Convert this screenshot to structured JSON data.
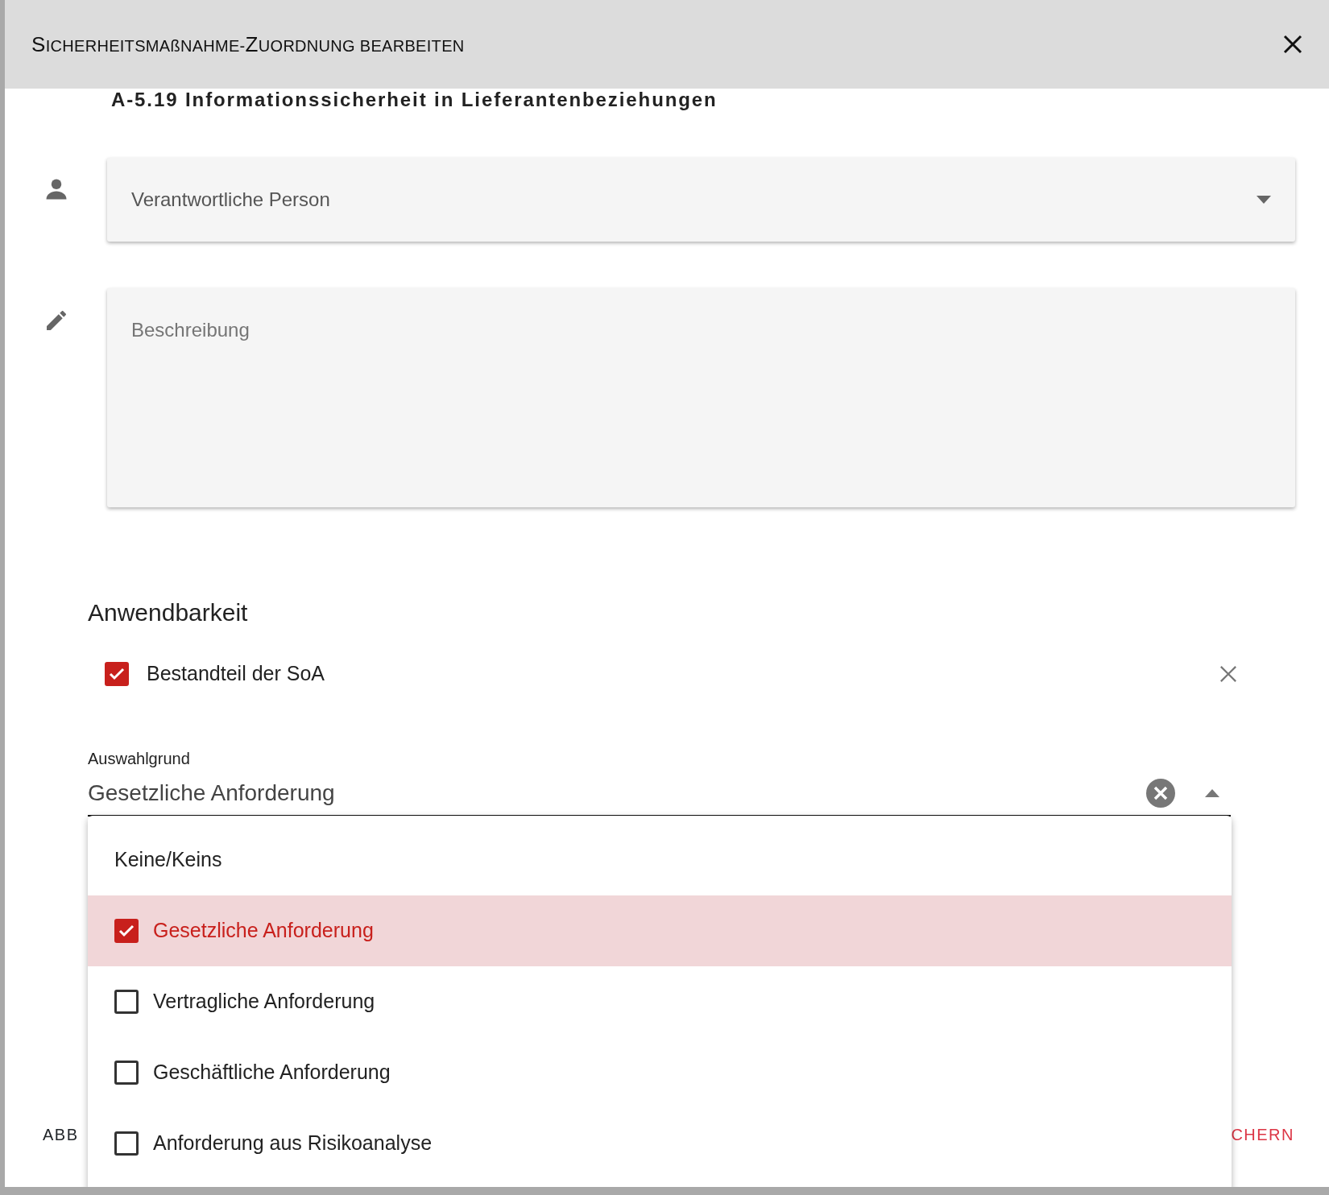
{
  "dialog": {
    "title": "SICHERHEITSMAßNAHME-ZUORDNUNG BEARBEITEN",
    "subtitle": "A-5.19 Informationssicherheit in Lieferantenbeziehungen"
  },
  "person_field": {
    "placeholder": "Verantwortliche Person"
  },
  "description_field": {
    "placeholder": "Beschreibung"
  },
  "applicability": {
    "heading": "Anwendbarkeit",
    "checkbox": {
      "label": "Bestandteil der SoA",
      "checked": true
    }
  },
  "selection_reason": {
    "label": "Auswahlgrund",
    "value": "Gesetzliche Anforderung",
    "expanded": true,
    "options": [
      {
        "label": "Keine/Keins",
        "kind": "plain",
        "selected": false
      },
      {
        "label": "Gesetzliche Anforderung",
        "kind": "checkbox",
        "selected": true
      },
      {
        "label": "Vertragliche Anforderung",
        "kind": "checkbox",
        "selected": false
      },
      {
        "label": "Geschäftliche Anforderung",
        "kind": "checkbox",
        "selected": false
      },
      {
        "label": "Anforderung aus Risikoanalyse",
        "kind": "checkbox",
        "selected": false
      }
    ]
  },
  "footer": {
    "cancel_button": "ABB",
    "save_button": "CHERN"
  }
}
